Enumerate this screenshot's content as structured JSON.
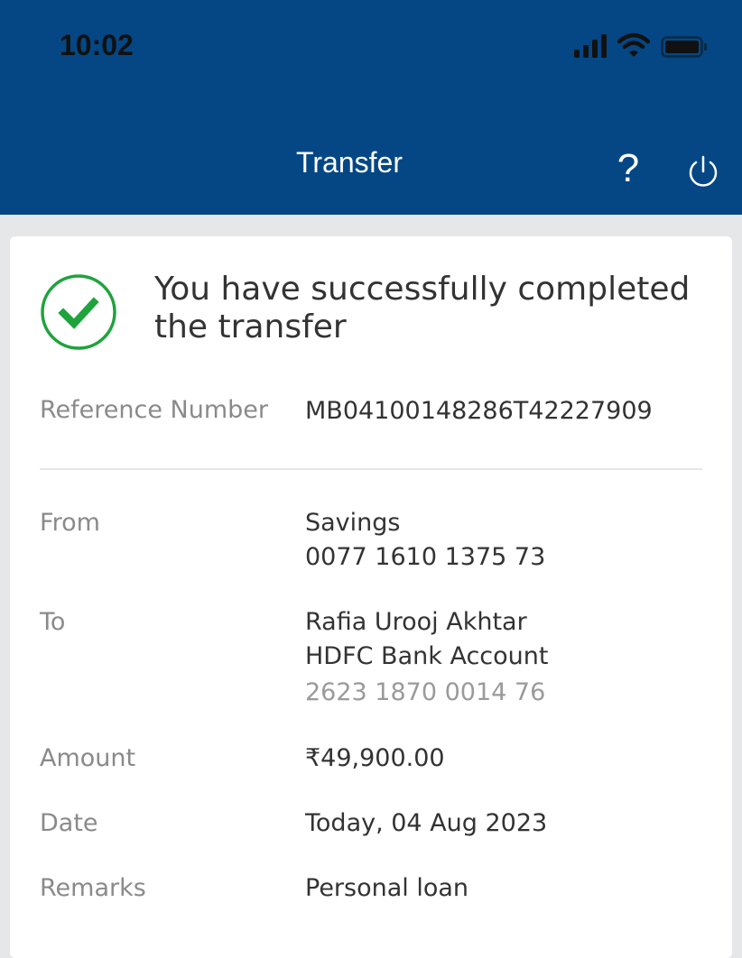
{
  "status_bar": {
    "time": "10:02"
  },
  "header": {
    "title": "Transfer",
    "help_label": "?",
    "background_color": "#044784"
  },
  "confirmation": {
    "message": "You have successfully completed the transfer",
    "success_color": "#1fa33d",
    "reference": {
      "label": "Reference Number",
      "value": "MB04100148286T42227909"
    },
    "from": {
      "label": "From",
      "account_type": "Savings",
      "account_number": "0077 1610 1375 73"
    },
    "to": {
      "label": "To",
      "name": "Rafia Urooj Akhtar",
      "bank": "HDFC Bank Account",
      "account_number": "2623 1870 0014 76"
    },
    "amount": {
      "label": "Amount",
      "value": "₹49,900.00"
    },
    "date": {
      "label": "Date",
      "value": "Today, 04 Aug 2023"
    },
    "remarks": {
      "label": "Remarks",
      "value": "Personal loan"
    }
  }
}
